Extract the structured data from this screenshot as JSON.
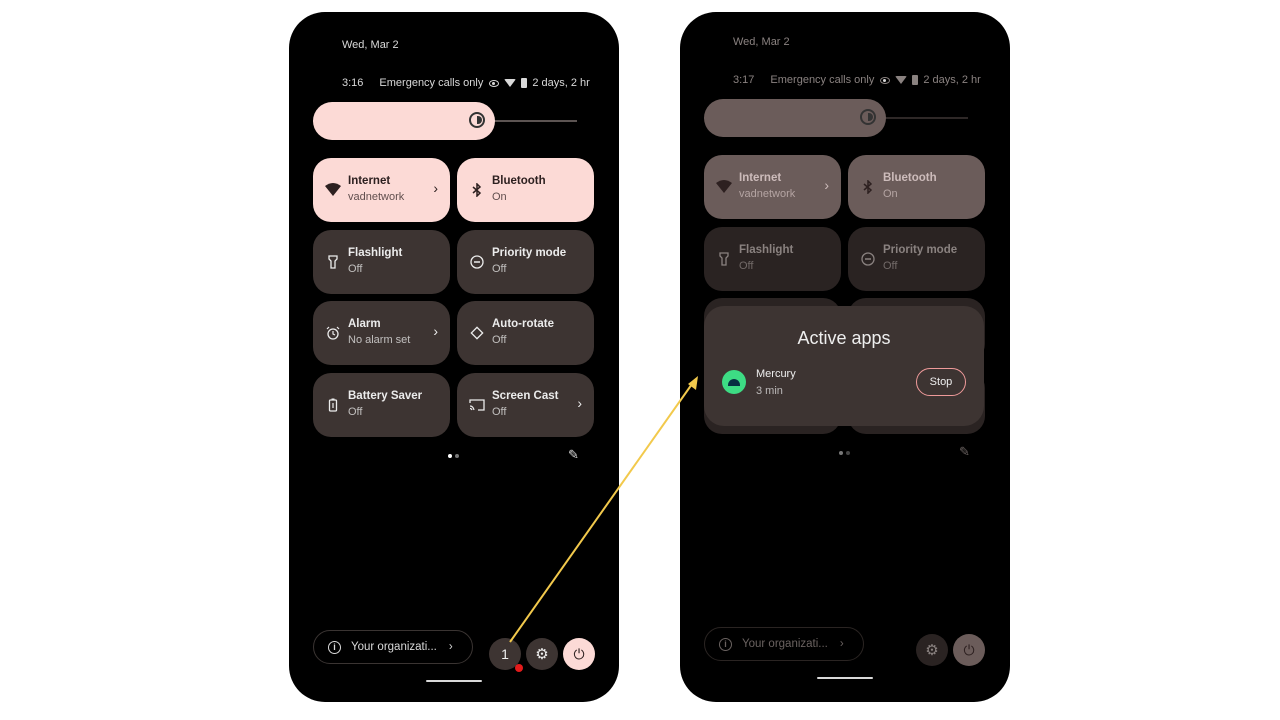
{
  "left": {
    "date": "Wed, Mar 2",
    "time": "3:16",
    "status": "Emergency calls only",
    "battery_text": "2 days, 2 hr",
    "tiles": [
      {
        "label": "Internet",
        "sub": "vadnetwork",
        "icon": "wifi-icon"
      },
      {
        "label": "Bluetooth",
        "sub": "On",
        "icon": "bluetooth-icon"
      },
      {
        "label": "Flashlight",
        "sub": "Off",
        "icon": "flashlight-icon"
      },
      {
        "label": "Priority mode",
        "sub": "Off",
        "icon": "do-not-disturb-icon"
      },
      {
        "label": "Alarm",
        "sub": "No alarm set",
        "icon": "alarm-icon"
      },
      {
        "label": "Auto-rotate",
        "sub": "Off",
        "icon": "rotate-icon"
      },
      {
        "label": "Battery Saver",
        "sub": "Off",
        "icon": "battery-icon"
      },
      {
        "label": "Screen Cast",
        "sub": "Off",
        "icon": "cast-icon"
      }
    ],
    "org_text": "Your organizati...",
    "active_count": "1"
  },
  "right": {
    "date": "Wed, Mar 2",
    "time": "3:17",
    "status": "Emergency calls only",
    "battery_text": "2 days, 2 hr",
    "tiles": [
      {
        "label": "Internet",
        "sub": "vadnetwork"
      },
      {
        "label": "Bluetooth",
        "sub": "On"
      },
      {
        "label": "Flashlight",
        "sub": "Off"
      },
      {
        "label": "Priority mode",
        "sub": "Off"
      }
    ],
    "org_text": "Your organizati...",
    "dialog": {
      "title": "Active apps",
      "app_name": "Mercury",
      "app_time": "3 min",
      "stop_label": "Stop"
    }
  },
  "colors": {
    "accent": "#fcdad6",
    "tile_bg": "#3d3432",
    "arrow": "#f2c94c",
    "badge": "#e31b1b"
  }
}
